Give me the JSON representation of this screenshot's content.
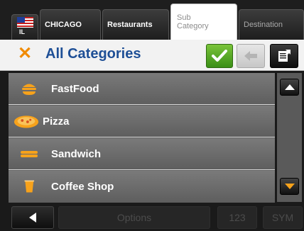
{
  "tabs": {
    "state": {
      "code": "IL",
      "flag_icon": "us-flag-icon"
    },
    "city": "CHICAGO",
    "category": "Restaurants",
    "subcategory_line1": "Sub",
    "subcategory_line2": "Category",
    "destination": "Destination"
  },
  "header": {
    "title": "All Categories",
    "close_icon": "x-icon",
    "confirm_icon": "checkmark-icon",
    "back_icon": "left-arrow-icon",
    "more_icon": "document-arrow-icon"
  },
  "list": {
    "items": [
      {
        "label": "FastFood",
        "icon": "burger-icon"
      },
      {
        "label": "Pizza",
        "icon": "pizza-icon"
      },
      {
        "label": "Sandwich",
        "icon": "sandwich-icon"
      },
      {
        "label": "Coffee Shop",
        "icon": "cup-icon"
      }
    ]
  },
  "scroll": {
    "up_icon": "triangle-up-icon",
    "down_icon": "triangle-down-icon"
  },
  "bottom": {
    "back_icon": "triangle-left-icon",
    "options": "Options",
    "numbers": "123",
    "symbols": "SYM"
  },
  "colors": {
    "accent_orange": "#f7a21b",
    "title_blue": "#1e4f96",
    "confirm_green": "#4ea51f"
  }
}
